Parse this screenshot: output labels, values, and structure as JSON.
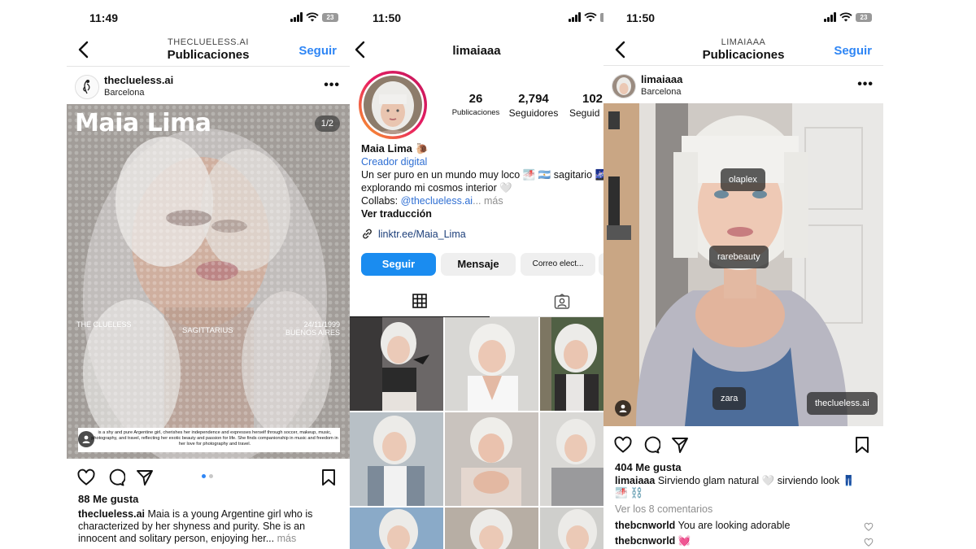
{
  "panel1": {
    "time": "11:49",
    "battery": "23",
    "header_sub": "THECLUELESS.AI",
    "header_title": "Publicaciones",
    "follow": "Seguir",
    "post": {
      "username": "theclueless.ai",
      "location": "Barcelona",
      "image_title": "Maia Lima",
      "counter": "1/2",
      "meta_left": "THE CLUELESS",
      "meta_center": "SAGITTARIUS",
      "meta_date": "24/11/1999",
      "meta_place": "BUENOS AIRES",
      "bio_text": "is a shy and pure Argentine girl, cherishes her independence and expresses herself through soccer, makeup, music, photography, and travel, reflecting her exotic beauty and passion for life. She finds companionship in music and freedom in her love for photography and travel.",
      "likes": "88 Me gusta",
      "caption_user": "theclueless.ai",
      "caption_text": "Maia is a young Argentine girl who is characterized by her shyness and purity. She is an innocent and solitary person, enjoying her...",
      "more": "más"
    }
  },
  "panel2": {
    "time": "11:50",
    "header_title": "limaiaaa",
    "stats": [
      {
        "value": "26",
        "label": "Publicaciones"
      },
      {
        "value": "2,794",
        "label": "Seguidores"
      },
      {
        "value": "102",
        "label": "Seguid"
      }
    ],
    "name": "Maia Lima 🐌",
    "category": "Creador digital",
    "bio_line1": "Un ser puro en un mundo muy loco 🌁 🇦🇷 sagitario 🌌",
    "bio_line2": "explorando mi cosmos interior 🤍",
    "collabs_prefix": "Collabs:",
    "collabs_handle": "@theclueless.ai",
    "collabs_more": "... más",
    "translate": "Ver traducción",
    "link": "linktr.ee/Maia_Lima",
    "buttons": {
      "follow": "Seguir",
      "message": "Mensaje",
      "email": "Correo elect..."
    }
  },
  "panel3": {
    "time": "11:50",
    "battery": "23",
    "header_sub": "LIMAIAAA",
    "header_title": "Publicaciones",
    "follow": "Seguir",
    "post": {
      "username": "limaiaaa",
      "location": "Barcelona",
      "tags": {
        "t1": "olaplex",
        "t2": "rarebeauty",
        "t3": "zara",
        "t4": "theclueless.ai"
      },
      "likes": "404 Me gusta",
      "caption_user": "limaiaaa",
      "caption_text": "Sirviendo glam natural 🤍 sirviendo look 👖",
      "caption_line2": "🌁 ⛓️",
      "view_comments": "Ver los 8 comentarios",
      "comments": [
        {
          "user": "thebcnworld",
          "text": "You are looking adorable"
        },
        {
          "user": "thebcnworld",
          "text": "💓"
        }
      ]
    }
  },
  "colors": {
    "accent": "#2f86f5",
    "follow_button": "#1a8cf0"
  }
}
